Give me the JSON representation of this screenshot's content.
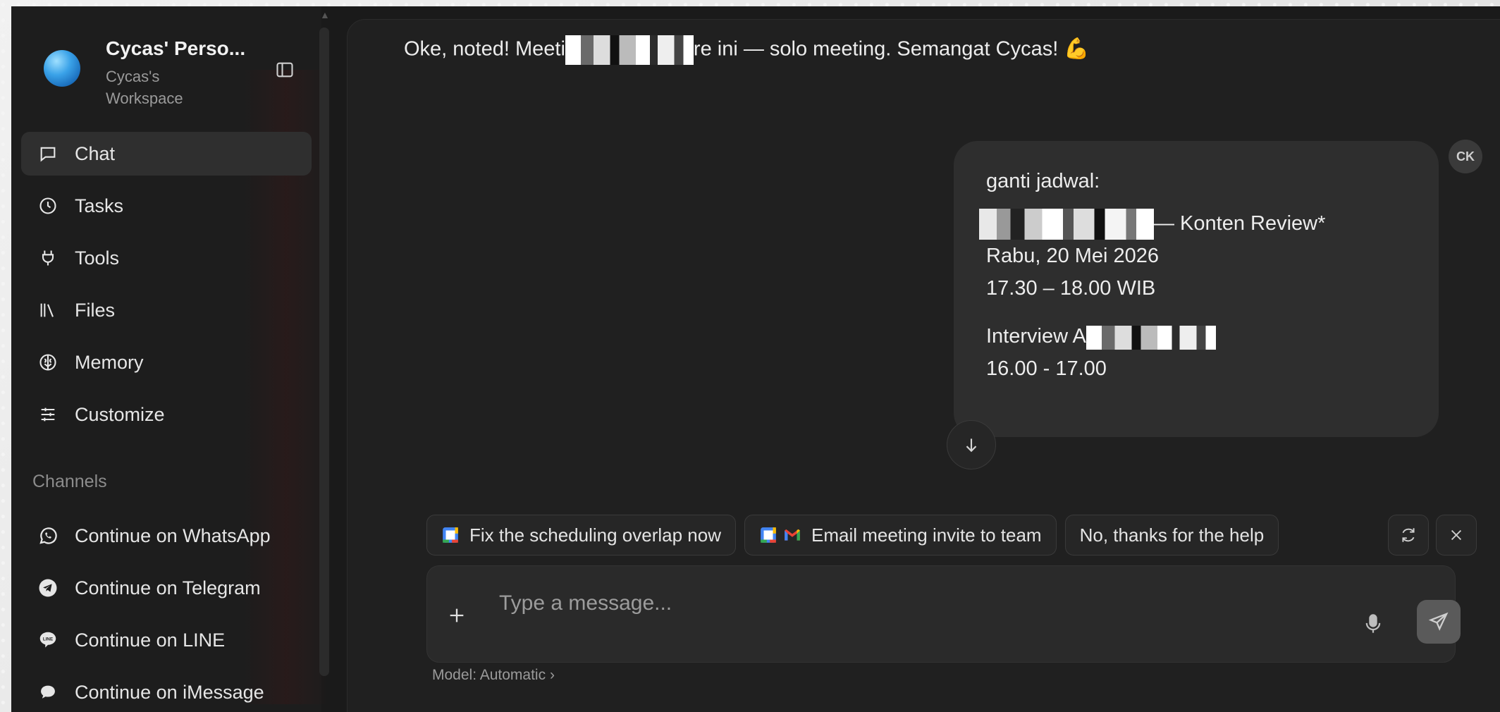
{
  "workspace": {
    "name": "Cycas' Perso...",
    "subtitle": "Cycas's Workspace"
  },
  "nav": {
    "items": [
      {
        "label": "Chat",
        "icon": "chat-icon"
      },
      {
        "label": "Tasks",
        "icon": "clock-icon"
      },
      {
        "label": "Tools",
        "icon": "plug-icon"
      },
      {
        "label": "Files",
        "icon": "files-icon"
      },
      {
        "label": "Memory",
        "icon": "memory-icon"
      },
      {
        "label": "Customize",
        "icon": "sliders-icon"
      }
    ]
  },
  "channels": {
    "label": "Channels",
    "items": [
      {
        "label": "Continue on WhatsApp",
        "icon": "whatsapp-icon"
      },
      {
        "label": "Continue on Telegram",
        "icon": "telegram-icon"
      },
      {
        "label": "Continue on LINE",
        "icon": "line-icon"
      },
      {
        "label": "Continue on iMessage",
        "icon": "imessage-icon"
      }
    ]
  },
  "conversation": {
    "assistant_part1": "Oke, noted! Meeti",
    "assistant_part2": "re ini — solo meeting. Semangat Cycas! 💪",
    "user_avatar": "CK",
    "user_lines": {
      "l1": "ganti jadwal:",
      "l2_suffix": "— Konten Review*",
      "l3": "Rabu, 20 Mei 2026",
      "l4": "17.30 – 18.00 WIB",
      "l5_prefix": "Interview A",
      "l6": "16.00 - 17.00"
    }
  },
  "suggestions": [
    {
      "label": "Fix the scheduling overlap now",
      "icons": [
        "google-calendar-icon"
      ]
    },
    {
      "label": "Email meeting invite to team",
      "icons": [
        "google-calendar-icon",
        "gmail-icon"
      ]
    },
    {
      "label": "No, thanks for the help",
      "icons": []
    }
  ],
  "composer": {
    "placeholder": "Type a message...",
    "model_label": "Model: Automatic",
    "model_chevron": "›"
  },
  "colors": {
    "app_bg": "#1a1a1a",
    "sidebar_bg": "#1d1d1d",
    "active_item": "#2f2f2f",
    "bubble": "#2e2e2e",
    "send_button": "#5a5a5a"
  }
}
